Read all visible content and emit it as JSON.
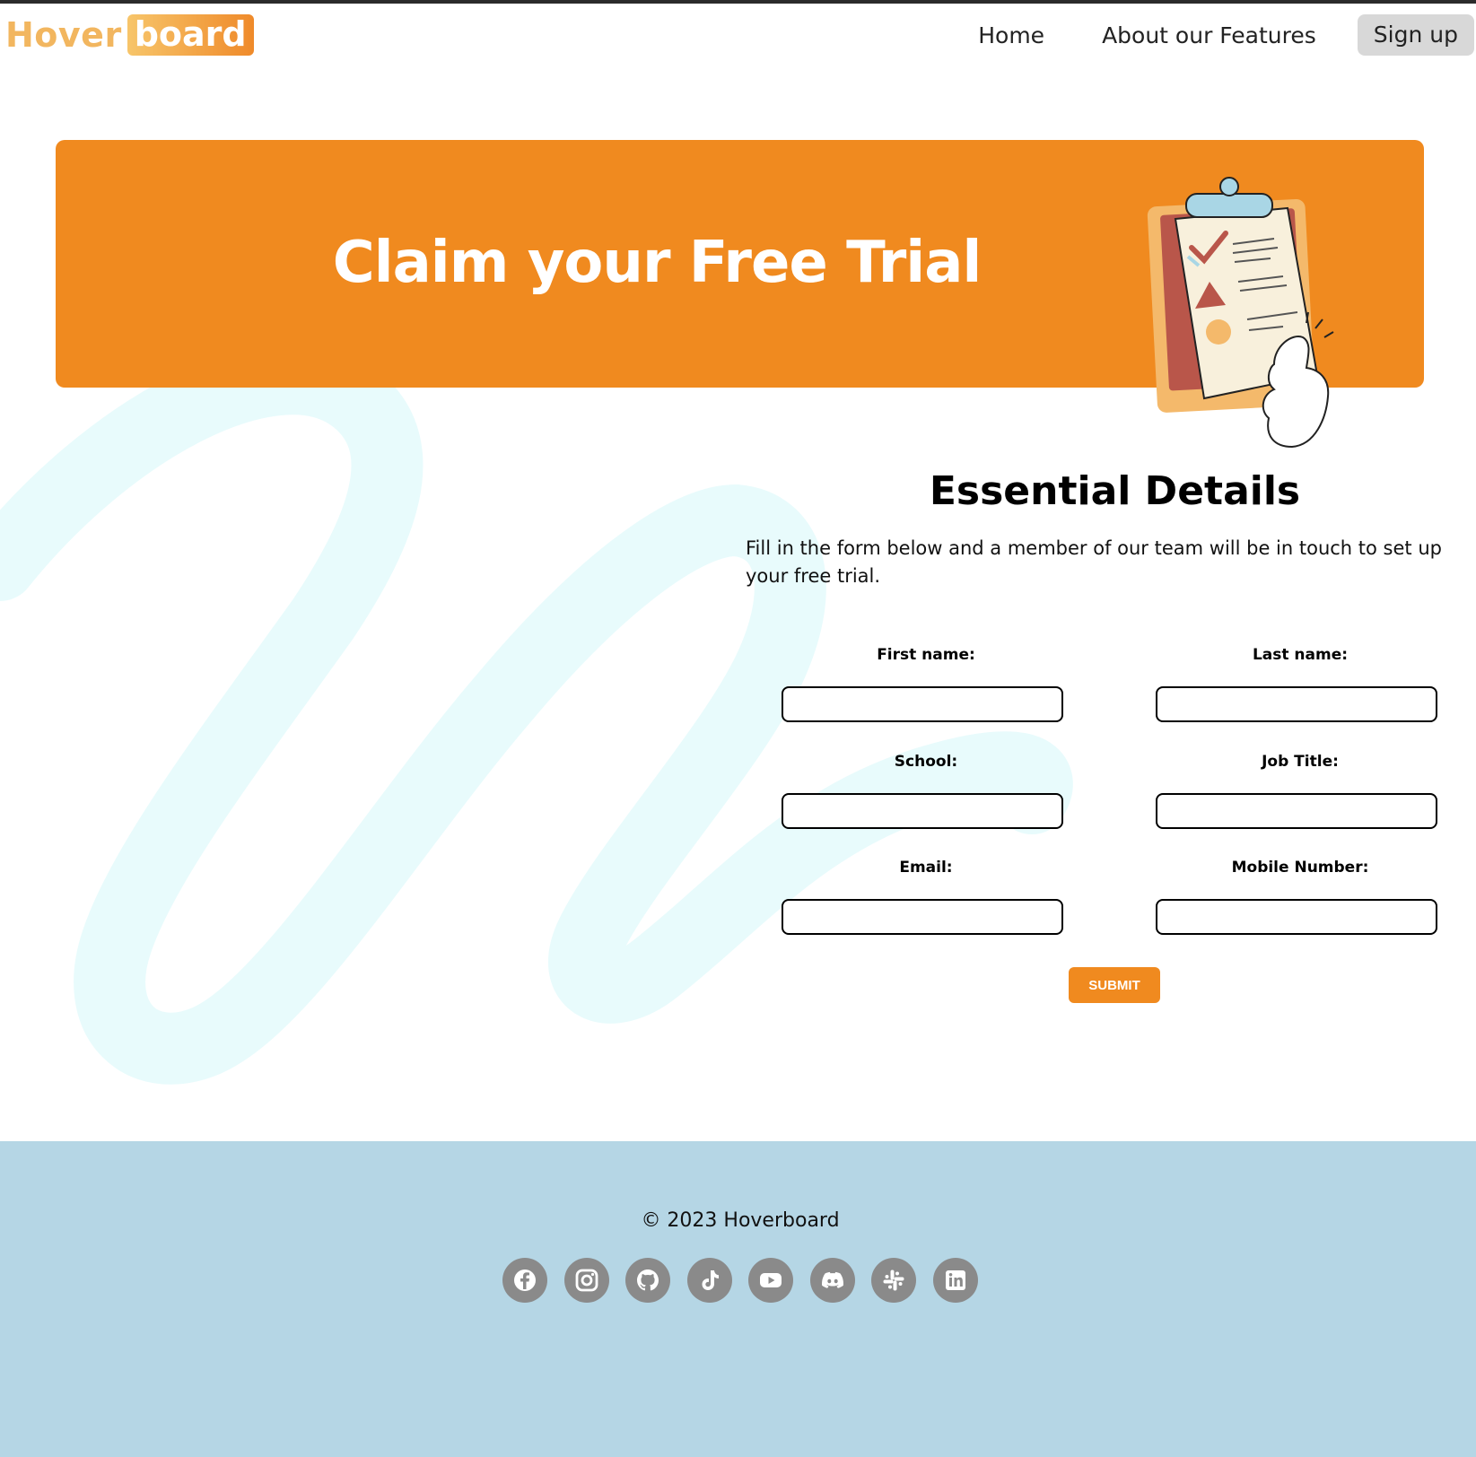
{
  "brand": {
    "logo_part1": "Hover",
    "logo_part2": "board"
  },
  "nav": {
    "home": "Home",
    "features": "About our Features",
    "signup": "Sign up"
  },
  "hero": {
    "title": "Claim your Free Trial"
  },
  "details": {
    "title": "Essential Details",
    "description": "Fill in the form below and a member of our team will be in touch to set up your free trial."
  },
  "form": {
    "first_name_label": "First name:",
    "last_name_label": "Last name:",
    "school_label": "School:",
    "job_title_label": "Job Title:",
    "email_label": "Email:",
    "mobile_label": "Mobile Number:",
    "first_name_value": "",
    "last_name_value": "",
    "school_value": "",
    "job_title_value": "",
    "email_value": "",
    "mobile_value": "",
    "submit_label": "SUBMIT"
  },
  "footer": {
    "copyright": "© 2023 Hoverboard",
    "socials": [
      "facebook-icon",
      "instagram-icon",
      "github-icon",
      "tiktok-icon",
      "youtube-icon",
      "discord-icon",
      "slack-icon",
      "linkedin-icon"
    ]
  },
  "colors": {
    "accent": "#f08a1f",
    "footer_bg": "#b5d6e5",
    "swirl": "#e8fbfc",
    "social_bg": "#8a8a8a",
    "signup_bg": "#d8d8d8"
  }
}
